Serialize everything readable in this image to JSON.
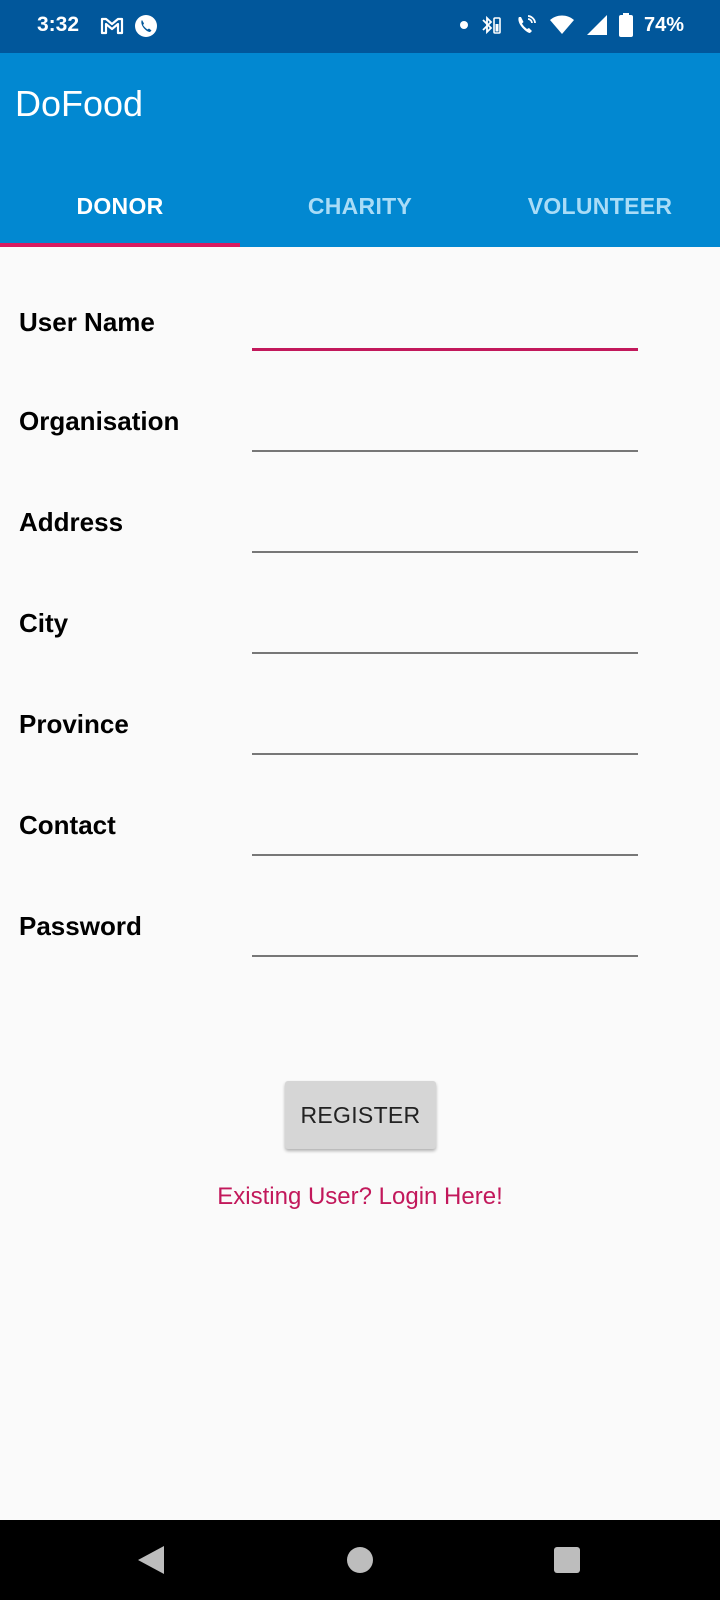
{
  "status_bar": {
    "time": "3:32",
    "battery_percent": "74%",
    "left_icons": [
      "gmail-icon",
      "phone-call-icon"
    ],
    "right_icons": [
      "dot-icon",
      "bluetooth-battery-icon",
      "wifi-call-icon",
      "wifi-icon",
      "signal-icon",
      "battery-icon"
    ]
  },
  "app_bar": {
    "title": "DoFood",
    "colors": {
      "status_bar": "#01579b",
      "app_bar": "#0288d1",
      "indicator": "#d81b60"
    }
  },
  "tabs": [
    {
      "label": "DONOR",
      "active": true
    },
    {
      "label": "CHARITY",
      "active": false
    },
    {
      "label": "VOLUNTEER",
      "active": false
    }
  ],
  "form": {
    "fields": [
      {
        "label": "User Name",
        "value": "",
        "placeholder": ""
      },
      {
        "label": "Organisation",
        "value": "",
        "placeholder": ""
      },
      {
        "label": "Address",
        "value": "",
        "placeholder": ""
      },
      {
        "label": "City",
        "value": "",
        "placeholder": ""
      },
      {
        "label": "Province",
        "value": "",
        "placeholder": ""
      },
      {
        "label": "Contact",
        "value": "",
        "placeholder": ""
      },
      {
        "label": "Password",
        "value": "",
        "placeholder": ""
      }
    ],
    "register_label": "REGISTER",
    "login_link": "Existing User? Login Here!",
    "accent_color": "#c2185b"
  },
  "nav_bar": {
    "buttons": [
      "back-icon",
      "home-icon",
      "recents-icon"
    ]
  }
}
